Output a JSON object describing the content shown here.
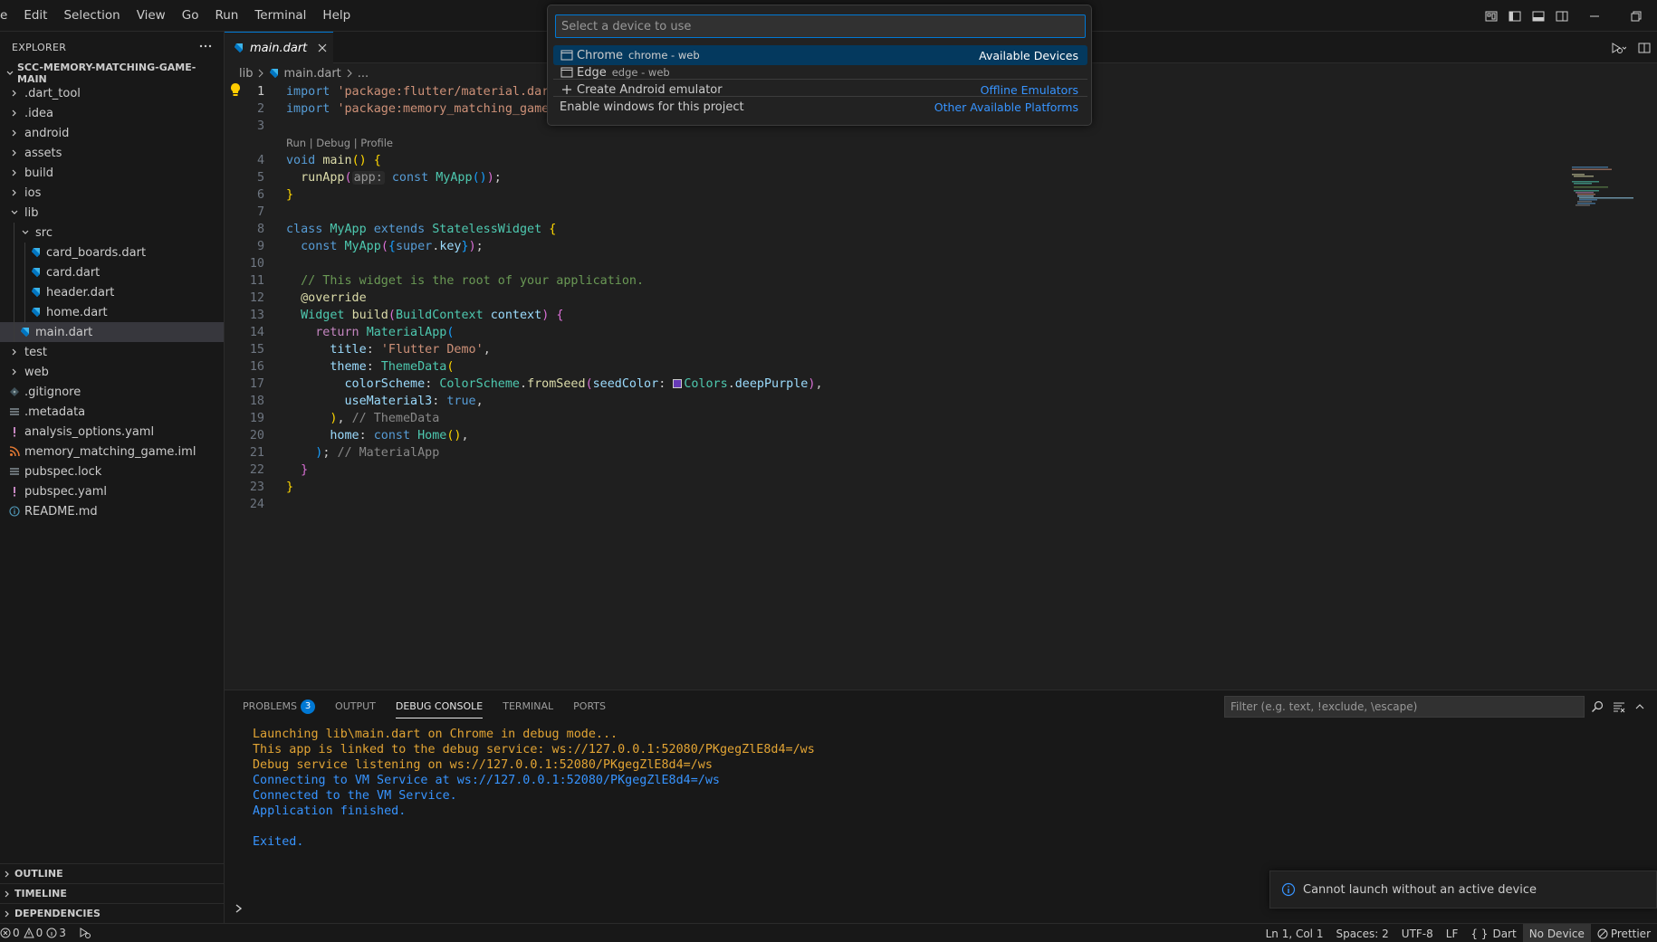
{
  "menubar": {
    "items": [
      "e",
      "Edit",
      "Selection",
      "View",
      "Go",
      "Run",
      "Terminal",
      "Help"
    ]
  },
  "explorer": {
    "title": "EXPLORER",
    "more_icon": "ellipsis-icon",
    "project": "SCC-MEMORY-MATCHING-GAME-MAIN",
    "tree": [
      {
        "label": ".dart_tool",
        "type": "folder",
        "depth": 0
      },
      {
        "label": ".idea",
        "type": "folder",
        "depth": 0
      },
      {
        "label": "android",
        "type": "folder",
        "depth": 0
      },
      {
        "label": "assets",
        "type": "folder",
        "depth": 0
      },
      {
        "label": "build",
        "type": "folder",
        "depth": 0
      },
      {
        "label": "ios",
        "type": "folder",
        "depth": 0
      },
      {
        "label": "lib",
        "type": "folder-open",
        "depth": 0
      },
      {
        "label": "src",
        "type": "folder-open",
        "depth": 1
      },
      {
        "label": "card_boards.dart",
        "type": "dart",
        "depth": 2
      },
      {
        "label": "card.dart",
        "type": "dart",
        "depth": 2
      },
      {
        "label": "header.dart",
        "type": "dart",
        "depth": 2
      },
      {
        "label": "home.dart",
        "type": "dart",
        "depth": 2
      },
      {
        "label": "main.dart",
        "type": "dart",
        "depth": 1,
        "selected": true
      },
      {
        "label": "test",
        "type": "folder",
        "depth": 0
      },
      {
        "label": "web",
        "type": "folder",
        "depth": 0
      },
      {
        "label": ".gitignore",
        "type": "git",
        "depth": 0
      },
      {
        "label": ".metadata",
        "type": "lines",
        "depth": 0
      },
      {
        "label": "analysis_options.yaml",
        "type": "yaml",
        "depth": 0
      },
      {
        "label": "memory_matching_game.iml",
        "type": "rss",
        "depth": 0
      },
      {
        "label": "pubspec.lock",
        "type": "lines",
        "depth": 0
      },
      {
        "label": "pubspec.yaml",
        "type": "yaml",
        "depth": 0
      },
      {
        "label": "README.md",
        "type": "info",
        "depth": 0
      }
    ],
    "sections": [
      "OUTLINE",
      "TIMELINE",
      "DEPENDENCIES"
    ]
  },
  "editor": {
    "tab_label": "main.dart",
    "breadcrumb": [
      "lib",
      "main.dart",
      "..."
    ],
    "codelens": "Run | Debug | Profile",
    "line_numbers": [
      "1",
      "2",
      "3",
      "4",
      "5",
      "6",
      "7",
      "8",
      "9",
      "10",
      "11",
      "12",
      "13",
      "14",
      "15",
      "16",
      "17",
      "18",
      "19",
      "20",
      "21",
      "22",
      "23",
      "24"
    ]
  },
  "quickpick": {
    "placeholder": "Select a device to use",
    "items": [
      {
        "label": "Chrome",
        "desc": "chrome - web",
        "group": "Available Devices",
        "icon": "device-window-icon"
      },
      {
        "label": "Edge",
        "desc": "edge - web",
        "group": "",
        "icon": "device-window-icon"
      },
      {
        "label": "Create Android emulator",
        "desc": "",
        "group": "Offline Emulators",
        "icon": "plus-icon"
      },
      {
        "label": "Enable windows for this project",
        "desc": "",
        "group": "Other Available Platforms",
        "icon": ""
      }
    ]
  },
  "panel": {
    "tabs": [
      {
        "label": "PROBLEMS",
        "badge": "3"
      },
      {
        "label": "OUTPUT"
      },
      {
        "label": "DEBUG CONSOLE",
        "active": true
      },
      {
        "label": "TERMINAL"
      },
      {
        "label": "PORTS"
      }
    ],
    "filter_placeholder": "Filter (e.g. text, !exclude, \\escape)",
    "console": [
      {
        "text": "Launching lib\\main.dart on Chrome in debug mode...",
        "color": "orange"
      },
      {
        "text": "This app is linked to the debug service: ws://127.0.0.1:52080/PKgegZlE8d4=/ws",
        "color": "orange"
      },
      {
        "text": "Debug service listening on ws://127.0.0.1:52080/PKgegZlE8d4=/ws",
        "color": "orange"
      },
      {
        "text": "Connecting to VM Service at ws://127.0.0.1:52080/PKgegZlE8d4=/ws",
        "color": "blue"
      },
      {
        "text": "Connected to the VM Service.",
        "color": "blue"
      },
      {
        "text": "Application finished.",
        "color": "blue"
      },
      {
        "text": "",
        "color": "blue"
      },
      {
        "text": "Exited.",
        "color": "blue"
      }
    ]
  },
  "notification": {
    "message": "Cannot launch without an active device"
  },
  "statusbar": {
    "errors": "0",
    "warnings": "0",
    "info": "3",
    "position": "Ln 1, Col 1",
    "spaces": "Spaces: 2",
    "encoding": "UTF-8",
    "eol": "LF",
    "language": "Dart",
    "device": "No Device",
    "formatter": "Prettier"
  },
  "colors": {
    "accent": "#0078d4",
    "console_orange": "#e2a434",
    "console_blue": "#3794ff",
    "deep_purple_swatch": "#673ab7"
  }
}
